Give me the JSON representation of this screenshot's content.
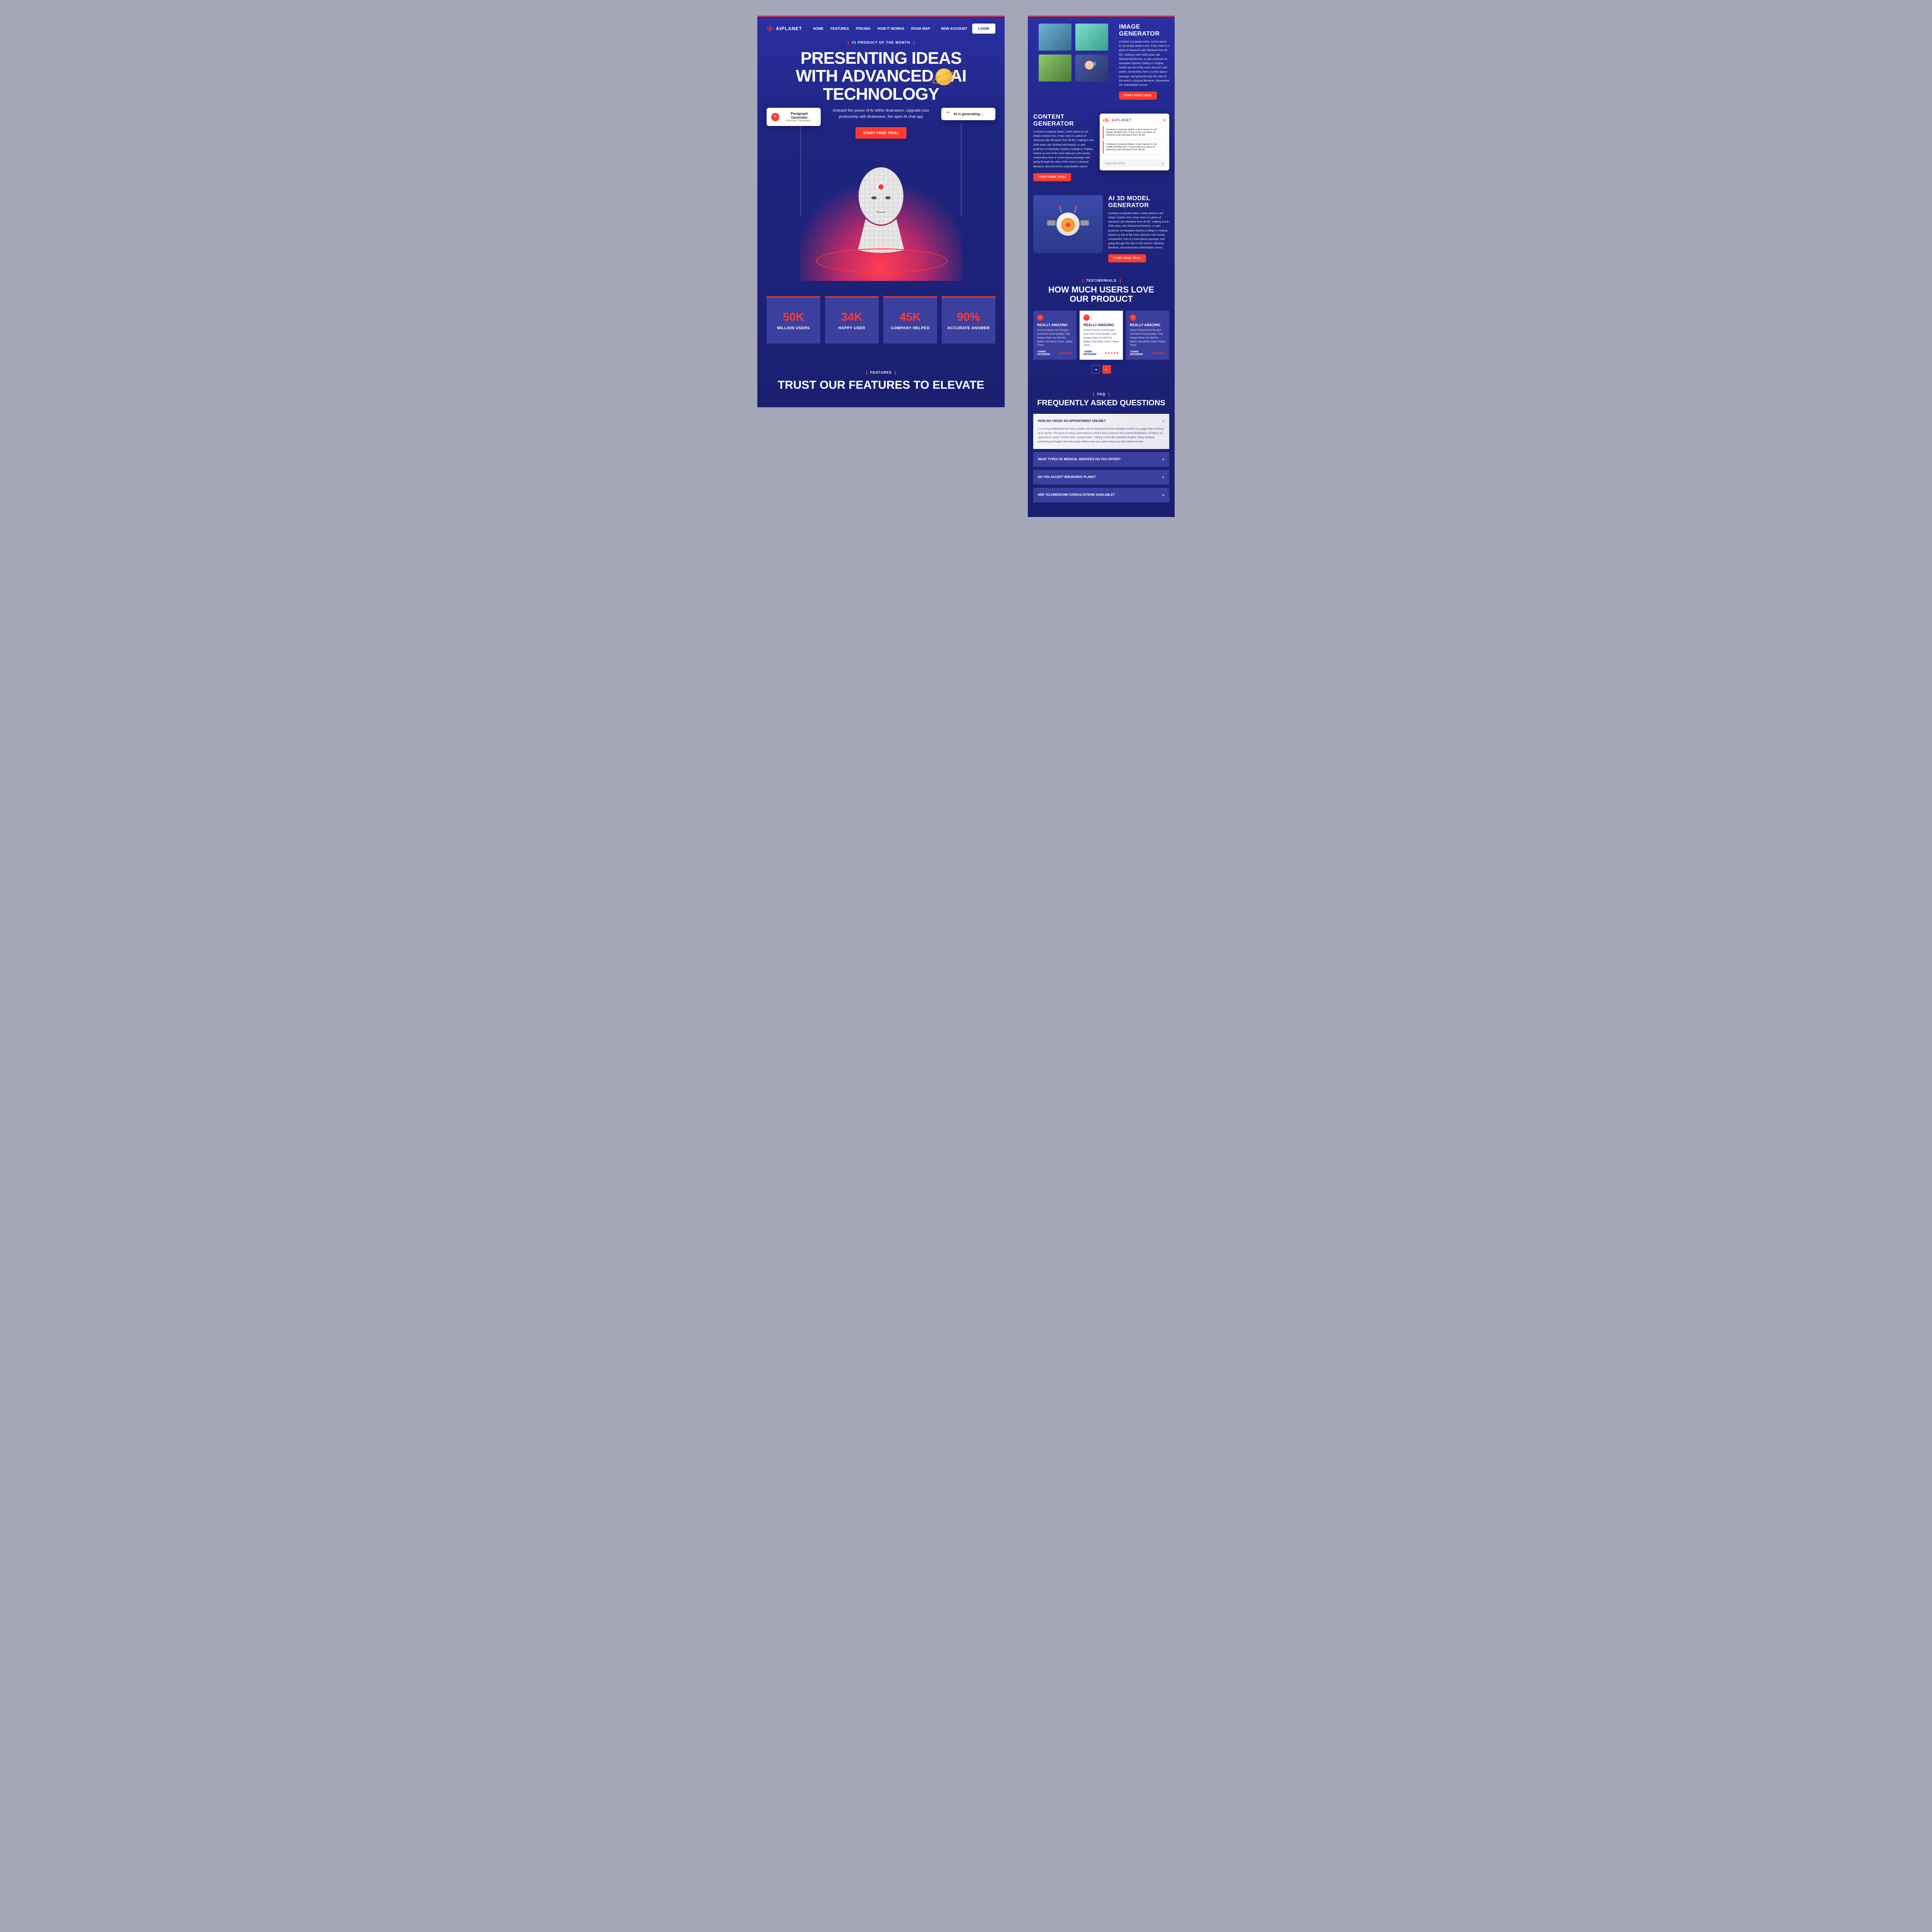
{
  "brand": "AIPLANET",
  "nav": [
    "HOME",
    "FEATURES",
    "PRICING",
    "HOW IT WORKS",
    "ROAD MAP"
  ],
  "navNewAccount": "NEW ACCOUNT",
  "navLogin": "LOGIN",
  "heroTag": "#1 PRODUCT OF THE MONTH",
  "heroLine1": "PRESENTING IDEAS",
  "heroLine2a": "WITH ADVANCED",
  "heroLine2b": "AI",
  "heroLine3": "TECHNOLOGY",
  "subtitle": "Unleash the power of AI within Brainwave. Upgrade your productivity with Brainwave, the open AI chat app",
  "cardLeftTitle": "Paragraph Generator",
  "cardLeftSub": "Generate Paragraph…",
  "cardRight": "Ai is generating…",
  "cta": "START FREE TRIAL",
  "stats": [
    {
      "v": "50K",
      "l": "MILLION USERS"
    },
    {
      "v": "34K",
      "l": "HAPPY USER"
    },
    {
      "v": "45K",
      "l": "COMPANY HELPED"
    },
    {
      "v": "90%",
      "l": "ACCURATE ANSWER"
    }
  ],
  "featuresTag": "FEATURES",
  "featuresHeadline": "TRUST OUR FEATURES TO ELEVATE",
  "imageGen": {
    "title": "IMAGE GENERATOR",
    "desc": "Contrary to popular belief, Lorem Ipsum is not simply random text. It has roots in a piece of classical Latin literature from 45 BC, making it over 2000 years old. Richard McClintock, a Latin professor at Hampden-Sydney College in Virginia, looked up one of the more obscure Latin words, consectetur, from a Lorem Ipsum passage, and going through the cites of the word in classical literature, discovered the undoubtable source."
  },
  "contentGen": {
    "title": "CONTENT GENERATOR",
    "desc": "Contrary to popular belief, Lorem Ipsum is not simply random text. It has roots in a piece of classical Latin literature from 45 BC, making it over 2000 years old. Richard McClintock, a Latin professor at Hampden-Sydney College in Virginia, looked up one of the more obscure Latin words, consectetur, from a Lorem Ipsum passage, and going through the cites of the word in classical literature, discovered the undoubtable source."
  },
  "chatMsg": "Contrary to popular belief, Lorem Ipsum is not simply random text. It has roots in a piece of classical Latin literature from 45 BC",
  "chatPlaceholder": "SEND MESSAGE",
  "modelGen": {
    "title": "AI 3D MODEL GENERATOR",
    "desc": "Contrary to popular belief, Lorem Ipsum is not simply random text. It has roots in a piece of classical Latin literature from 45 BC, making it over 2000 years old. Richard McClintock, a Latin professor at Hampden-Sydney College in Virginia, looked up one of the more obscure Latin words, consectetur, from a Lorem Ipsum passage, and going through the cites of the word in classical literature, discovered the undoubtable source."
  },
  "testiTag": "TESTIMONIALS",
  "testiHeadline1": "HOW MUCH USERS LOVE",
  "testiHeadline2": "OUR PRODUCT",
  "tcard": {
    "title": "REALLY AMAZING",
    "body": "Great Products And Designs And Such Great Quality, They Always Wash Up Well No Matter How Many Times I Wash Them.",
    "who": "-SAMA HOSSEINI"
  },
  "faqTag": "FAQ",
  "faqHeadline": "FREQUENTLY ASKED QUESTIONS",
  "faq": [
    {
      "q": "HOW DO I BOOK AN APPOINTMENT ONLINE?",
      "a": "t is a long established fact that a reader will be distracted by the readable content of a page when looking at its layout. The point of using Lorem Ipsum is that it has a more-or-less normal distribution of letters, as opposed to using 'Content here, content here', making it look like readable English. Many desktop publishing packages and web page editors now use Lorem Ipsum as their default model"
    },
    {
      "q": "WHAT TYPES OF MEDICAL SERVICES DO YOU OFFER?"
    },
    {
      "q": "DO YOU ACCEPT INSURANCE PLANS?"
    },
    {
      "q": "ARE TELEMEDICINE CONSULTATIONS AVAILABLE?"
    }
  ]
}
